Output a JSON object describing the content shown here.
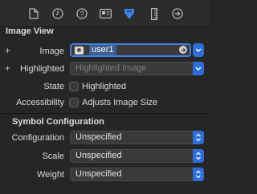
{
  "toolbar": {
    "tabs": [
      {
        "icon": "file-icon"
      },
      {
        "icon": "clock-icon"
      },
      {
        "icon": "help-icon"
      },
      {
        "icon": "identity-card-icon"
      },
      {
        "icon": "attributes-inspector-icon",
        "selected": true
      },
      {
        "icon": "ruler-icon"
      },
      {
        "icon": "connections-arrow-icon"
      }
    ],
    "accent_color": "#3d7fe0"
  },
  "image_view": {
    "title": "Image View",
    "image": {
      "label": "Image",
      "value": "user1"
    },
    "highlighted": {
      "label": "Highlighted",
      "placeholder": "Highlighted Image"
    },
    "state": {
      "label": "State",
      "checkbox_label": "Highlighted",
      "checked": false
    },
    "accessibility": {
      "label": "Accessibility",
      "checkbox_label": "Adjusts Image Size",
      "checked": false
    }
  },
  "symbol_configuration": {
    "title": "Symbol Configuration",
    "configuration": {
      "label": "Configuration",
      "value": "Unspecified"
    },
    "scale": {
      "label": "Scale",
      "value": "Unspecified"
    },
    "weight": {
      "label": "Weight",
      "value": "Unspecified"
    }
  }
}
